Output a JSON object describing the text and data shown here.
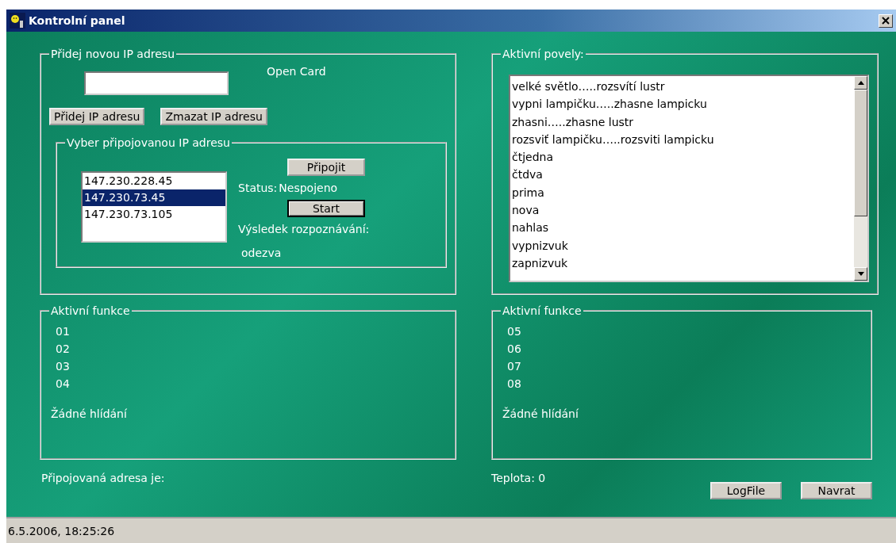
{
  "window": {
    "title": "Kontrolní panel"
  },
  "add_ip": {
    "legend": "Přidej novou IP adresu",
    "open_card": "Open Card",
    "buttons": [
      "Přidej IP adresu",
      "Zmazat IP adresu"
    ],
    "select_ip": {
      "legend": "Vyber připojovanou IP adresu",
      "addresses": [
        {
          "text": "147.230.228.45",
          "selected": false
        },
        {
          "text": "147.230.73.45",
          "selected": true
        },
        {
          "text": "147.230.73.105",
          "selected": false
        }
      ],
      "connect_button": "Připojit",
      "status_label": "Status:",
      "status_value": "Nespojeno",
      "start_button": "Start",
      "result_label": "Výsledek rozpoznávání:",
      "result_value": "odezva"
    }
  },
  "commands": {
    "legend": "Aktivní povely:",
    "items": [
      "velké světlo…..rozsvítí lustr",
      "vypni lampičku…..zhasne lampicku",
      "zhasni…..zhasne lustr",
      "rozsviť lampičku…..rozsviti lampicku",
      "čtjedna",
      "čtdva",
      "prima",
      "nova",
      "nahlas",
      "vypnizvuk",
      "zapnizvuk"
    ]
  },
  "functions": [
    {
      "legend": "Aktivní funkce",
      "items": [
        "01",
        "02",
        "03",
        "04"
      ],
      "watch": "Žádné hlídání"
    },
    {
      "legend": "Aktivní funkce",
      "items": [
        "05",
        "06",
        "07",
        "08"
      ],
      "watch": "Žádné hlídání"
    }
  ],
  "connected_address": "Připojovaná adresa je:",
  "temperature": "Teplota: 0",
  "buttons": [
    "LogFile",
    "Navrat"
  ],
  "status_bar": "6.5.2006, 18:25:26"
}
